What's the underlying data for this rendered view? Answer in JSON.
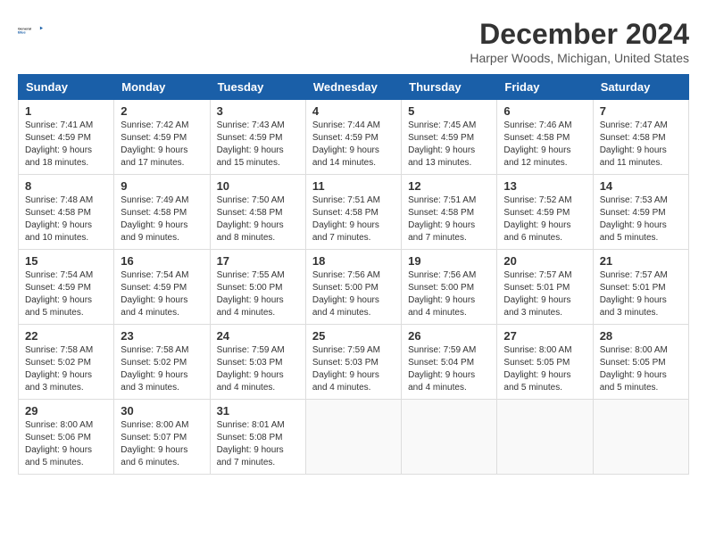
{
  "header": {
    "logo_line1": "General",
    "logo_line2": "Blue",
    "month_title": "December 2024",
    "location": "Harper Woods, Michigan, United States"
  },
  "weekdays": [
    "Sunday",
    "Monday",
    "Tuesday",
    "Wednesday",
    "Thursday",
    "Friday",
    "Saturday"
  ],
  "days": [
    {
      "num": "",
      "sunrise": "",
      "sunset": "",
      "daylight": ""
    },
    {
      "num": "1",
      "sunrise": "Sunrise: 7:41 AM",
      "sunset": "Sunset: 4:59 PM",
      "daylight": "Daylight: 9 hours and 18 minutes."
    },
    {
      "num": "2",
      "sunrise": "Sunrise: 7:42 AM",
      "sunset": "Sunset: 4:59 PM",
      "daylight": "Daylight: 9 hours and 17 minutes."
    },
    {
      "num": "3",
      "sunrise": "Sunrise: 7:43 AM",
      "sunset": "Sunset: 4:59 PM",
      "daylight": "Daylight: 9 hours and 15 minutes."
    },
    {
      "num": "4",
      "sunrise": "Sunrise: 7:44 AM",
      "sunset": "Sunset: 4:59 PM",
      "daylight": "Daylight: 9 hours and 14 minutes."
    },
    {
      "num": "5",
      "sunrise": "Sunrise: 7:45 AM",
      "sunset": "Sunset: 4:59 PM",
      "daylight": "Daylight: 9 hours and 13 minutes."
    },
    {
      "num": "6",
      "sunrise": "Sunrise: 7:46 AM",
      "sunset": "Sunset: 4:58 PM",
      "daylight": "Daylight: 9 hours and 12 minutes."
    },
    {
      "num": "7",
      "sunrise": "Sunrise: 7:47 AM",
      "sunset": "Sunset: 4:58 PM",
      "daylight": "Daylight: 9 hours and 11 minutes."
    },
    {
      "num": "8",
      "sunrise": "Sunrise: 7:48 AM",
      "sunset": "Sunset: 4:58 PM",
      "daylight": "Daylight: 9 hours and 10 minutes."
    },
    {
      "num": "9",
      "sunrise": "Sunrise: 7:49 AM",
      "sunset": "Sunset: 4:58 PM",
      "daylight": "Daylight: 9 hours and 9 minutes."
    },
    {
      "num": "10",
      "sunrise": "Sunrise: 7:50 AM",
      "sunset": "Sunset: 4:58 PM",
      "daylight": "Daylight: 9 hours and 8 minutes."
    },
    {
      "num": "11",
      "sunrise": "Sunrise: 7:51 AM",
      "sunset": "Sunset: 4:58 PM",
      "daylight": "Daylight: 9 hours and 7 minutes."
    },
    {
      "num": "12",
      "sunrise": "Sunrise: 7:51 AM",
      "sunset": "Sunset: 4:58 PM",
      "daylight": "Daylight: 9 hours and 7 minutes."
    },
    {
      "num": "13",
      "sunrise": "Sunrise: 7:52 AM",
      "sunset": "Sunset: 4:59 PM",
      "daylight": "Daylight: 9 hours and 6 minutes."
    },
    {
      "num": "14",
      "sunrise": "Sunrise: 7:53 AM",
      "sunset": "Sunset: 4:59 PM",
      "daylight": "Daylight: 9 hours and 5 minutes."
    },
    {
      "num": "15",
      "sunrise": "Sunrise: 7:54 AM",
      "sunset": "Sunset: 4:59 PM",
      "daylight": "Daylight: 9 hours and 5 minutes."
    },
    {
      "num": "16",
      "sunrise": "Sunrise: 7:54 AM",
      "sunset": "Sunset: 4:59 PM",
      "daylight": "Daylight: 9 hours and 4 minutes."
    },
    {
      "num": "17",
      "sunrise": "Sunrise: 7:55 AM",
      "sunset": "Sunset: 5:00 PM",
      "daylight": "Daylight: 9 hours and 4 minutes."
    },
    {
      "num": "18",
      "sunrise": "Sunrise: 7:56 AM",
      "sunset": "Sunset: 5:00 PM",
      "daylight": "Daylight: 9 hours and 4 minutes."
    },
    {
      "num": "19",
      "sunrise": "Sunrise: 7:56 AM",
      "sunset": "Sunset: 5:00 PM",
      "daylight": "Daylight: 9 hours and 4 minutes."
    },
    {
      "num": "20",
      "sunrise": "Sunrise: 7:57 AM",
      "sunset": "Sunset: 5:01 PM",
      "daylight": "Daylight: 9 hours and 3 minutes."
    },
    {
      "num": "21",
      "sunrise": "Sunrise: 7:57 AM",
      "sunset": "Sunset: 5:01 PM",
      "daylight": "Daylight: 9 hours and 3 minutes."
    },
    {
      "num": "22",
      "sunrise": "Sunrise: 7:58 AM",
      "sunset": "Sunset: 5:02 PM",
      "daylight": "Daylight: 9 hours and 3 minutes."
    },
    {
      "num": "23",
      "sunrise": "Sunrise: 7:58 AM",
      "sunset": "Sunset: 5:02 PM",
      "daylight": "Daylight: 9 hours and 3 minutes."
    },
    {
      "num": "24",
      "sunrise": "Sunrise: 7:59 AM",
      "sunset": "Sunset: 5:03 PM",
      "daylight": "Daylight: 9 hours and 4 minutes."
    },
    {
      "num": "25",
      "sunrise": "Sunrise: 7:59 AM",
      "sunset": "Sunset: 5:03 PM",
      "daylight": "Daylight: 9 hours and 4 minutes."
    },
    {
      "num": "26",
      "sunrise": "Sunrise: 7:59 AM",
      "sunset": "Sunset: 5:04 PM",
      "daylight": "Daylight: 9 hours and 4 minutes."
    },
    {
      "num": "27",
      "sunrise": "Sunrise: 8:00 AM",
      "sunset": "Sunset: 5:05 PM",
      "daylight": "Daylight: 9 hours and 5 minutes."
    },
    {
      "num": "28",
      "sunrise": "Sunrise: 8:00 AM",
      "sunset": "Sunset: 5:05 PM",
      "daylight": "Daylight: 9 hours and 5 minutes."
    },
    {
      "num": "29",
      "sunrise": "Sunrise: 8:00 AM",
      "sunset": "Sunset: 5:06 PM",
      "daylight": "Daylight: 9 hours and 5 minutes."
    },
    {
      "num": "30",
      "sunrise": "Sunrise: 8:00 AM",
      "sunset": "Sunset: 5:07 PM",
      "daylight": "Daylight: 9 hours and 6 minutes."
    },
    {
      "num": "31",
      "sunrise": "Sunrise: 8:01 AM",
      "sunset": "Sunset: 5:08 PM",
      "daylight": "Daylight: 9 hours and 7 minutes."
    }
  ]
}
